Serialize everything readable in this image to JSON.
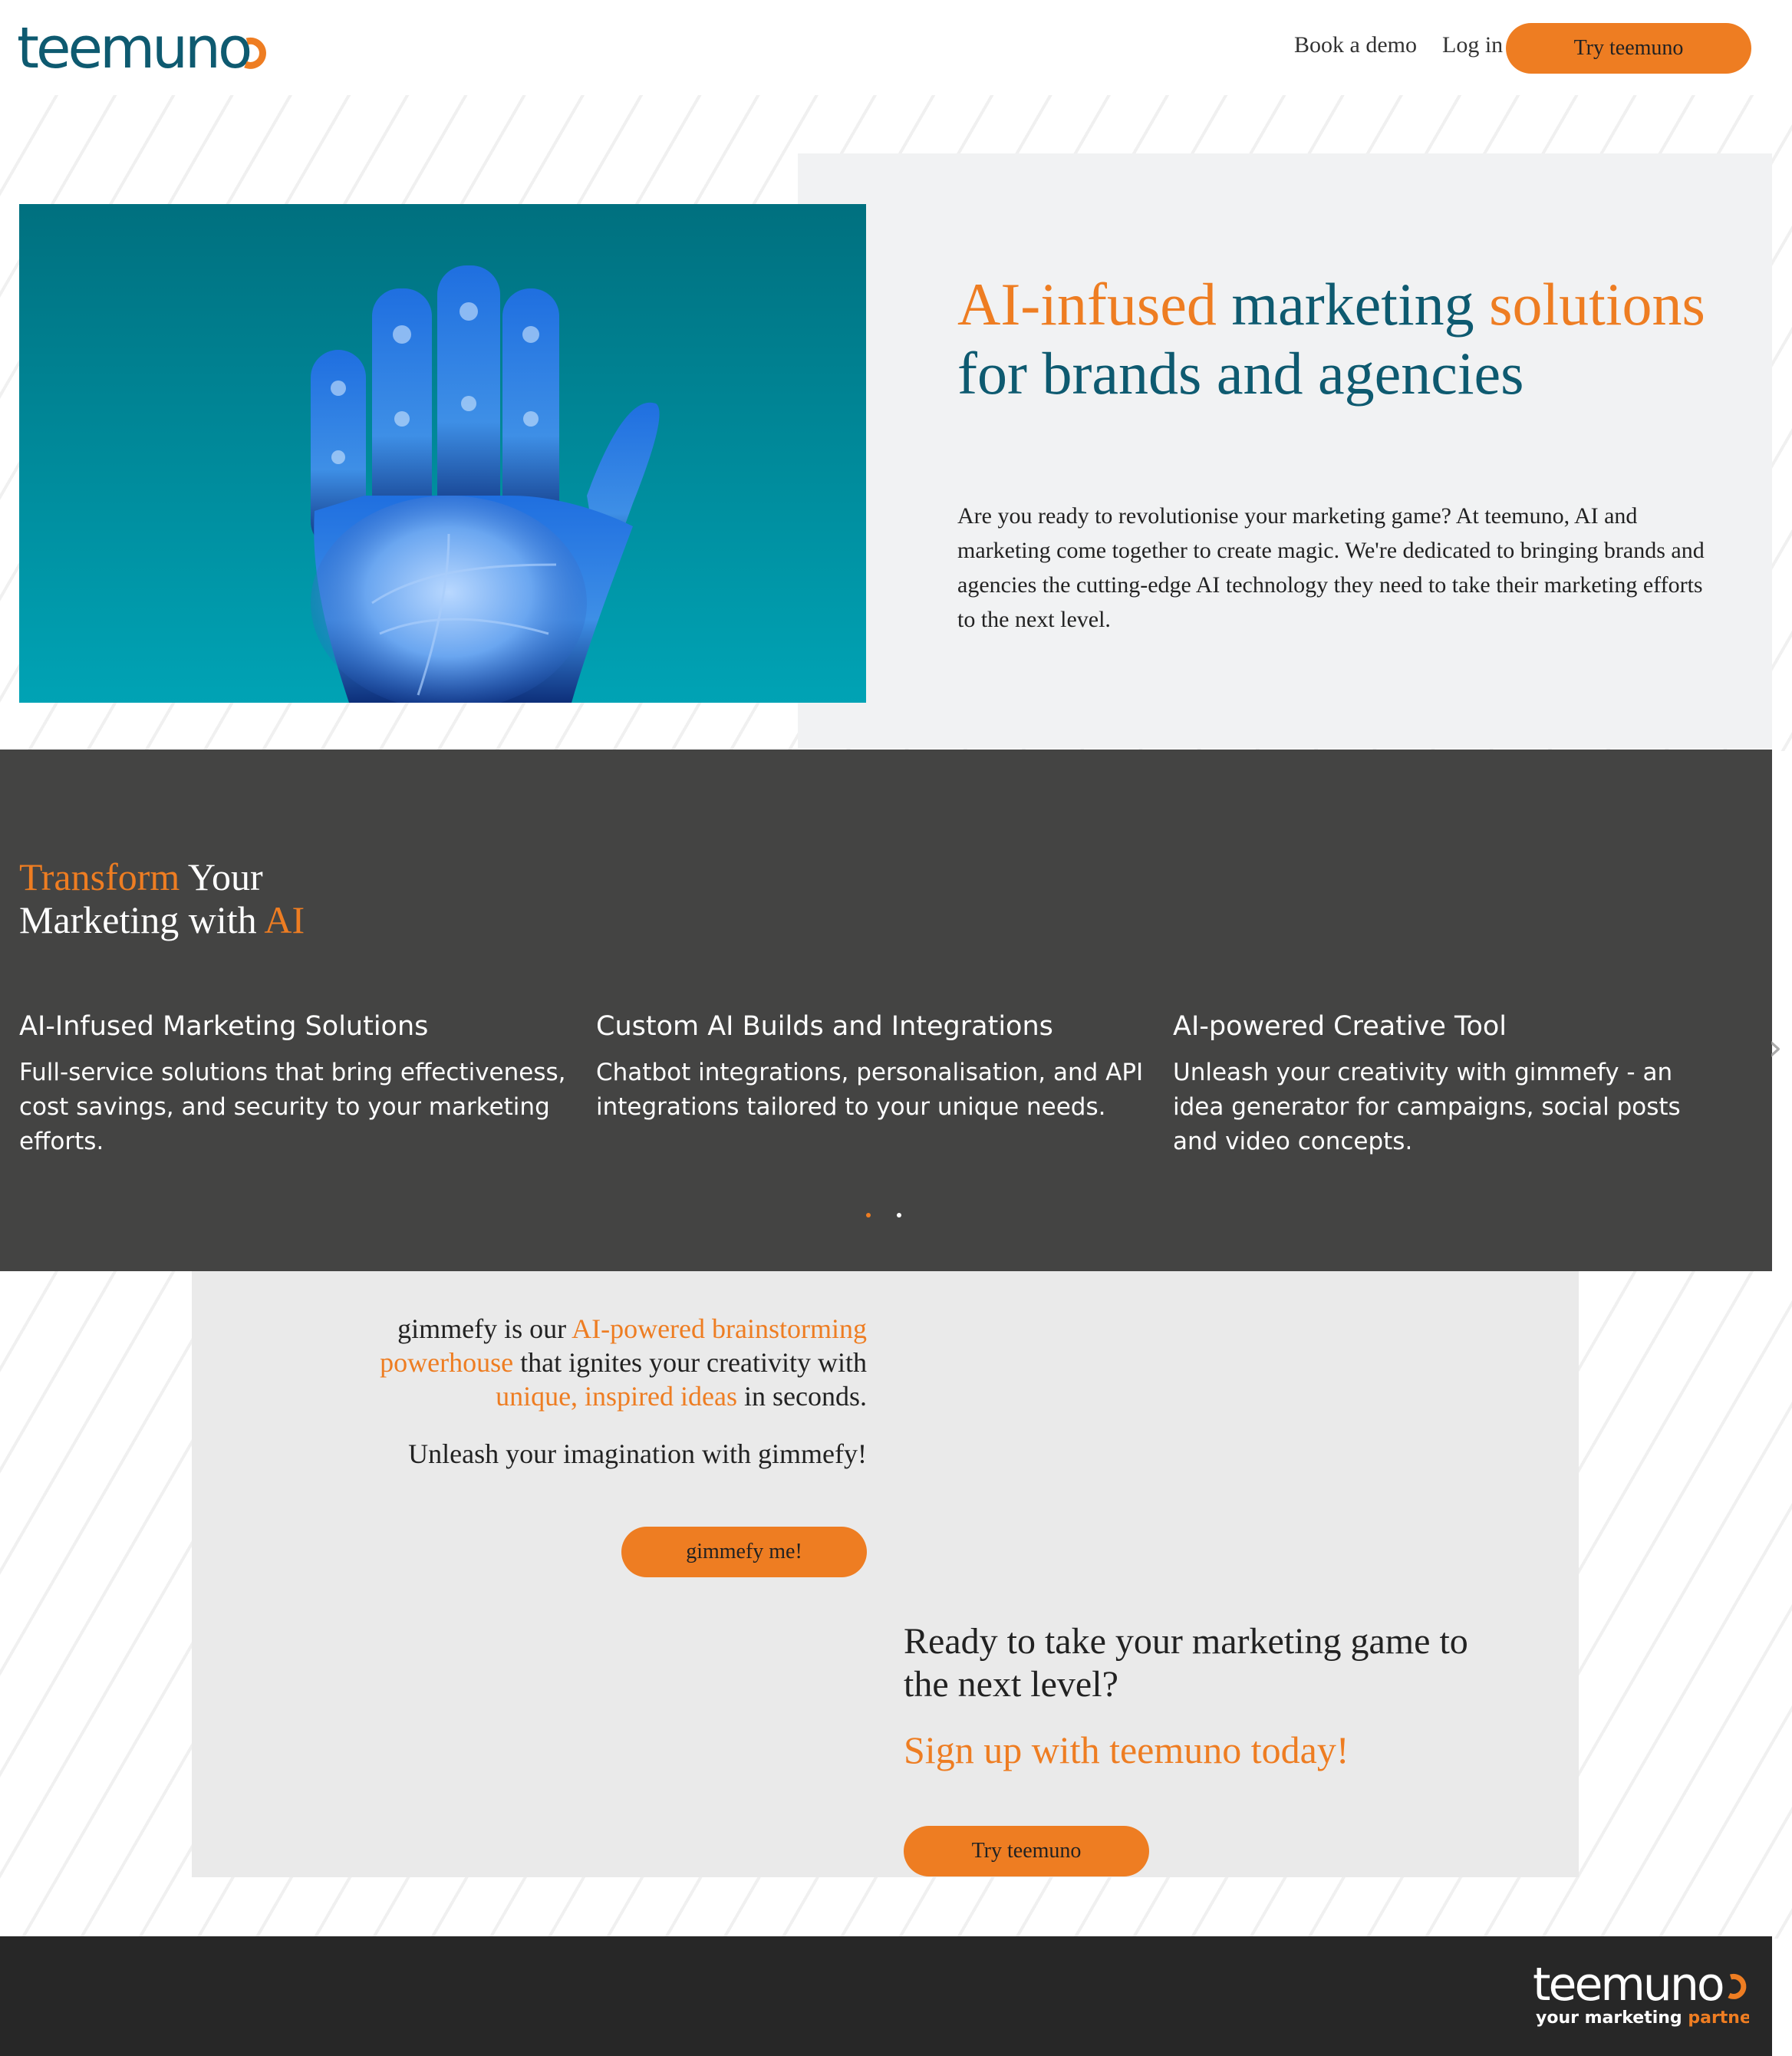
{
  "header": {
    "logo_text": "teemuno",
    "nav": [
      {
        "label": "Book a demo"
      },
      {
        "label": "Log in"
      }
    ],
    "cta_label": "Try teemuno"
  },
  "hero": {
    "title_parts": [
      "AI-infused",
      " marketing ",
      "solutions",
      " for brands and agencies"
    ],
    "description": "Are you ready to revolutionise your marketing game? At teemuno, AI and marketing come together to create magic. We're dedicated to bringing brands and agencies the cutting-edge AI technology they need to take their marketing efforts to the next level.",
    "image": "robotic-hand-image"
  },
  "services": {
    "title_parts": [
      "Transform",
      " Your",
      "Marketing with ",
      "AI"
    ],
    "cards": [
      {
        "title": "AI-Infused Marketing Solutions",
        "text": "Full-service solutions that bring effectiveness, cost savings, and security to your marketing efforts."
      },
      {
        "title": "Custom AI Builds and Integrations",
        "text": "Chatbot integrations, personalisation, and API integrations tailored to your unique needs."
      },
      {
        "title": "AI-powered Creative Tool",
        "text": "Unleash your creativity with gimmefy - an idea generator for campaigns, social posts and video concepts."
      }
    ],
    "next_arrow": "›",
    "colors": {
      "active_dot": "#ee7d22",
      "inactive_dot": "#ffffff"
    }
  },
  "gimmefy": {
    "text_parts": [
      "gimmefy is our ",
      "AI-powered brainstorming powerhouse",
      " that ignites your creativity with ",
      "unique, inspired ideas",
      " in seconds."
    ],
    "tagline": "Unleash your imagination with gimmefy!",
    "button_label": "gimmefy me!"
  },
  "signup": {
    "heading": "Ready to take your marketing game to the next level?",
    "subheading": "Sign up with teemuno today!",
    "button_label": "Try teemuno"
  },
  "footer": {
    "logo_text": "teemuno",
    "tagline_parts": [
      "your marketing ",
      "partner"
    ]
  },
  "colors": {
    "accent": "#ee7d22",
    "brand_teal": "#0e5a70",
    "dark_band": "#444443",
    "footer": "#272727"
  }
}
